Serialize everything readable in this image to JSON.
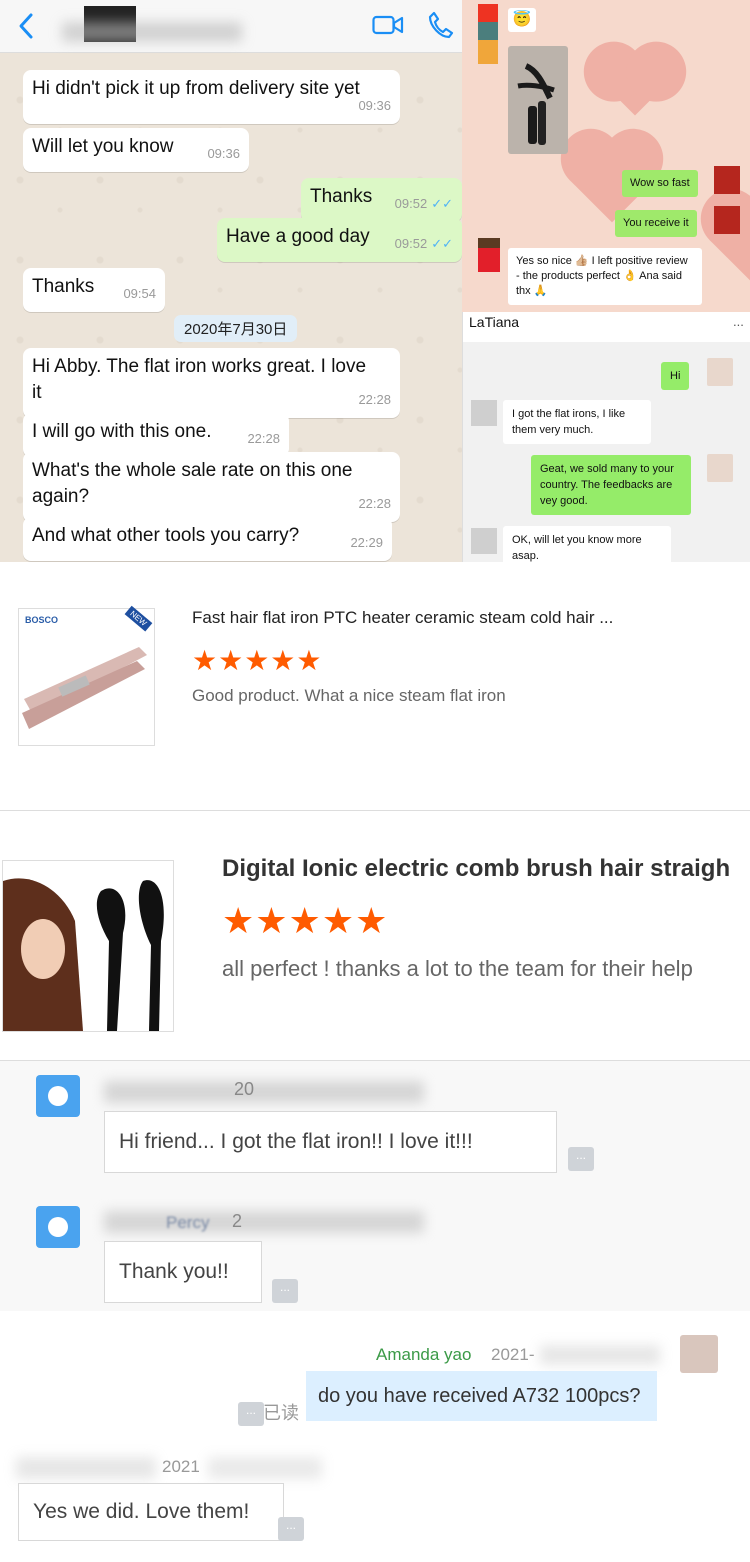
{
  "whatsapp": {
    "messages": [
      {
        "text": "Hi didn't pick it up from delivery site yet",
        "time": "09:36"
      },
      {
        "text": "Will let you know",
        "time": "09:36"
      },
      {
        "text": "Thanks",
        "time": "09:52"
      },
      {
        "text": "Have a good day",
        "time": "09:52"
      },
      {
        "text": "Thanks",
        "time": "09:54"
      },
      {
        "text": "Hi Abby. The flat iron works great. I love it",
        "time": "22:28"
      },
      {
        "text": "I will go with this one.",
        "time": "22:28"
      },
      {
        "text": "What's the whole sale rate on this one again?",
        "time": "22:28"
      },
      {
        "text": "And what other tools you carry?",
        "time": "22:29"
      }
    ],
    "date_chip": "2020年7月30日",
    "read_ticks": "✓✓",
    "icons": {
      "back": "chevron-left-icon",
      "video": "video-camera-icon",
      "phone": "phone-icon"
    }
  },
  "pink_chat": {
    "emoji": "😇",
    "msg1": "Wow so fast",
    "msg2": "You receive it",
    "msg3": "Yes so nice 👍🏼 I left positive review - the products perfect 👌 Ana said thx 🙏"
  },
  "latiana": {
    "title": "LaTiana",
    "menu": "...",
    "msg_hi": "Hi",
    "msg_got": "I got the flat irons, I like them very much.",
    "msg_sold": "Geat, we sold many to your country. The feedbacks are vey good.",
    "msg_ok": "OK, will let you know more asap."
  },
  "review1": {
    "brand": "BOSCO",
    "tag": "NEW",
    "title": "Fast hair flat iron PTC heater ceramic steam cold hair ...",
    "stars": "★★★★★",
    "rating": 5,
    "comment": "Good product. What a nice steam flat iron"
  },
  "review2": {
    "title": "Digital Ionic electric comb brush hair straigh",
    "stars": "★★★★★",
    "rating": 5,
    "comment": "all perfect ! thanks a lot to the team for their help"
  },
  "comments": {
    "msg1": "Hi friend... I got the flat iron!! I love it!!!",
    "msg2": "Thank you!!",
    "dots": "...",
    "name2_partial": "Percy",
    "name1_partial": "20",
    "name2_year": "2"
  },
  "amanda_chat": {
    "sender": "Amanda yao",
    "sender_date": "2021-",
    "msg_out": "do you have received A732 100pcs?",
    "read_label": "已读",
    "reply_date": "2021",
    "msg_in": "Yes we did. Love them!",
    "dots": "..."
  },
  "colors": {
    "wa_green": "#dcf8c6",
    "wa_blue": "#1a8ef5",
    "star_orange": "#ff5b00",
    "amanda_green": "#3b9a47"
  }
}
